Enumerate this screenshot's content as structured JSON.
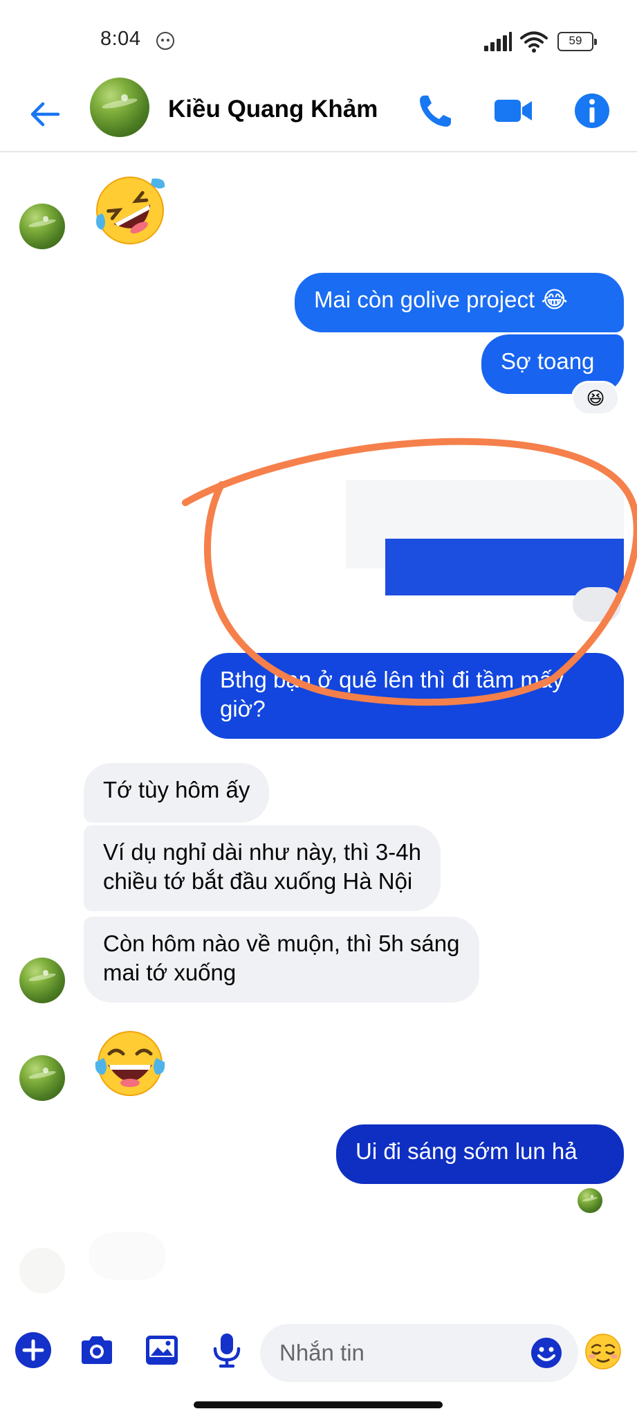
{
  "status_bar": {
    "time": "8:04",
    "battery": "59"
  },
  "header": {
    "contact_name": "Kiều Quang Khảm"
  },
  "messages": {
    "out_1": "Mai còn golive project 😂",
    "out_2": "Sợ toang",
    "out_2_reaction": "😆",
    "out_3_line1": "Bthg bạn ở quê lên thì đi tầm mấy",
    "out_3_line2": "giờ?",
    "in_1": "Tớ tùy hôm ấy",
    "in_2_line1": "Ví dụ nghỉ dài như này, thì 3-4h",
    "in_2_line2": "chiều tớ bắt đầu xuống Hà Nội",
    "in_3_line1": "Còn hôm nào về muộn, thì 5h sáng",
    "in_3_line2": "mai tớ xuống",
    "out_4": "Ui đi sáng sớm lun hả"
  },
  "composer": {
    "placeholder": "Nhắn tin"
  },
  "colors": {
    "brand_blue": "#1877f2",
    "bubble_blue_light": "#1a6cf2",
    "bubble_blue_dark": "#0f32c8",
    "annotation_orange": "#f5804b"
  }
}
